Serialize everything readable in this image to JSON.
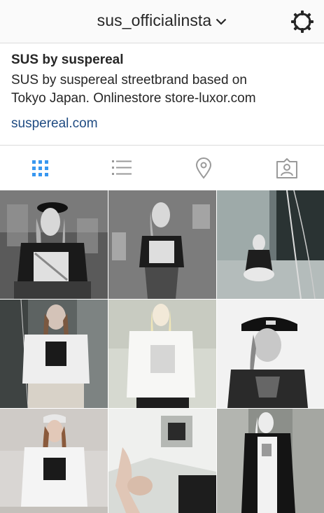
{
  "header": {
    "username": "sus_officialinsta",
    "dropdown_icon": "chevron-down-icon",
    "settings_icon": "gear-icon"
  },
  "profile": {
    "name": "SUS by suspereal",
    "bio_line1": "SUS by suspereal streetbrand based on",
    "bio_line2": "Tokyo Japan. Onlinestore store-luxor.com",
    "website": "suspereal.com"
  },
  "tabs": [
    {
      "icon": "grid-icon",
      "active": true
    },
    {
      "icon": "list-icon",
      "active": false
    },
    {
      "icon": "location-pin-icon",
      "active": false
    },
    {
      "icon": "tagged-person-icon",
      "active": false
    }
  ],
  "colors": {
    "accent": "#3897f0",
    "link": "#1f4b82",
    "icon_inactive": "#9a9a9a"
  },
  "photos": [
    {
      "tone": "dark"
    },
    {
      "tone": "grey"
    },
    {
      "tone": "blue-grey"
    },
    {
      "tone": "grey-green"
    },
    {
      "tone": "light"
    },
    {
      "tone": "light-dark"
    },
    {
      "tone": "light"
    },
    {
      "tone": "light"
    },
    {
      "tone": "grey"
    }
  ]
}
